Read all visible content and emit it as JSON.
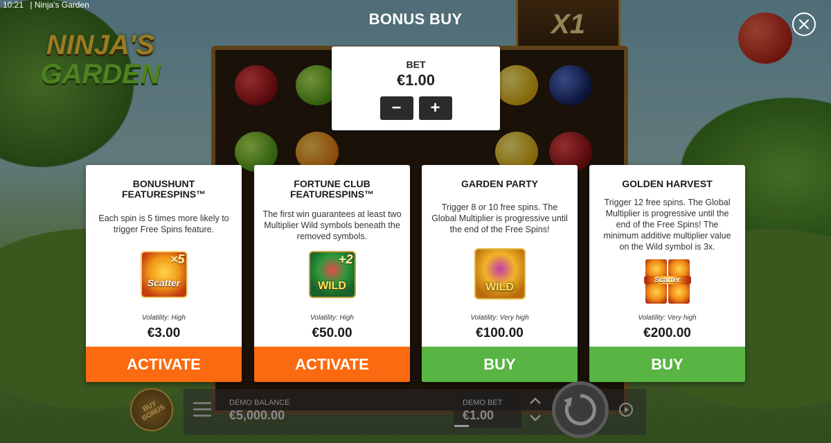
{
  "status_bar": {
    "time": "10:21",
    "app_title": "| Ninja's Garden"
  },
  "logo": {
    "line1": "NINJA'S",
    "line2": "GARDEN"
  },
  "background": {
    "multiplier": "X1"
  },
  "header": {
    "title": "BONUS BUY"
  },
  "bet": {
    "label": "BET",
    "value": "€1.00",
    "minus": "−",
    "plus": "+"
  },
  "cards": [
    {
      "title": "BONUSHUNT FEATURESPINS™",
      "description": "Each spin is 5 times more likely to trigger Free Spins feature.",
      "icon": "scatter-x5-icon",
      "icon_label": "Scatter",
      "icon_multiplier": "×5",
      "volatility": "Volatility: High",
      "price": "€3.00",
      "action": "ACTIVATE",
      "action_color": "#fb6a10"
    },
    {
      "title": "FORTUNE CLUB FEATURESPINS™",
      "description": "The first win guarantees at least two Multiplier Wild symbols beneath the removed symbols.",
      "icon": "wild-x2-icon",
      "icon_label": "WILD",
      "icon_multiplier": "+2",
      "volatility": "Volatility: High",
      "price": "€50.00",
      "action": "ACTIVATE",
      "action_color": "#fb6a10"
    },
    {
      "title": "GARDEN PARTY",
      "description": "Trigger 8 or 10 free spins. The Global Multiplier is progressive until the end of the Free Spins!",
      "icon": "wild-fruit-bowl-icon",
      "icon_label": "WILD",
      "volatility": "Volatility: Very high",
      "price": "€100.00",
      "action": "BUY",
      "action_color": "#58b443"
    },
    {
      "title": "GOLDEN HARVEST",
      "description": "Trigger 12 free spins. The Global Multiplier is progressive until the end of the Free Spins! The minimum additive multiplier value on the Wild symbol is 3x.",
      "icon": "quad-scatter-icon",
      "icon_label": "Scatter",
      "volatility": "Volatility: Very high",
      "price": "€200.00",
      "action": "BUY",
      "action_color": "#58b443"
    }
  ],
  "bottom_bar": {
    "buy_bonus": "BUY BONUS",
    "demo_balance_label": "DEMO BALANCE",
    "demo_balance_value": "€5,000.00",
    "demo_bet_label": "DEMO BET",
    "demo_bet_value": "€1.00"
  }
}
